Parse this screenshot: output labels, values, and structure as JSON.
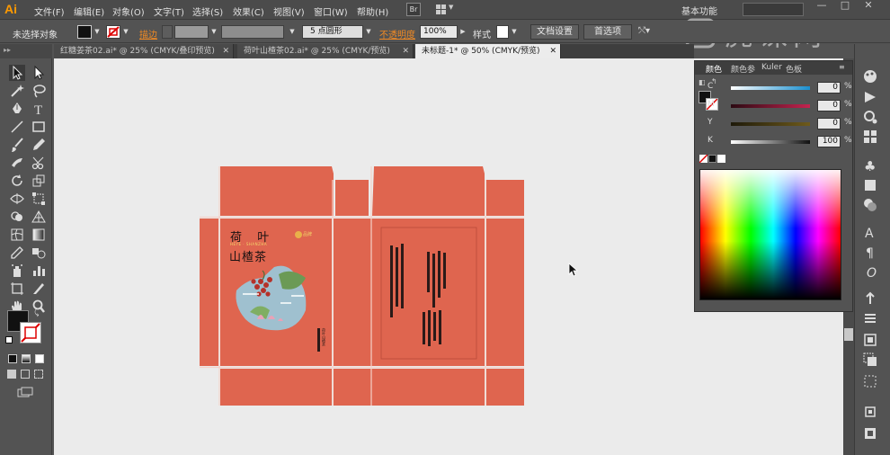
{
  "app": {
    "logo": "Ai"
  },
  "menu": [
    "文件(F)",
    "编辑(E)",
    "对象(O)",
    "文字(T)",
    "选择(S)",
    "效果(C)",
    "视图(V)",
    "窗口(W)",
    "帮助(H)"
  ],
  "bridge_label": "Br",
  "workspace": {
    "label": "基本功能"
  },
  "window_controls": {
    "minimize": "—",
    "restore": "□",
    "close": "✕"
  },
  "watermark": {
    "text": "虎课网"
  },
  "control_bar": {
    "selection_status": "未选择对象",
    "stroke_label": "描边",
    "brush_value": "5 点圆形",
    "opacity_label": "不透明度",
    "opacity_value": "100%",
    "style_label": "样式",
    "doc_setup_button": "文档设置",
    "preferences_button": "首选项"
  },
  "tabs": [
    {
      "title": "红糖姜茶02.ai* @ 25% (CMYK/叠印预览)",
      "active": false,
      "close": "✕"
    },
    {
      "title": "荷叶山楂茶02.ai* @ 25% (CMYK/预览)",
      "active": false,
      "close": "✕"
    },
    {
      "title": "未标题-1* @ 50% (CMYK/预览)",
      "active": true,
      "close": "✕"
    }
  ],
  "color_panel": {
    "tabs": [
      "颜色",
      "颜色参",
      "Kuler",
      "色板"
    ],
    "channels": [
      {
        "label": "C",
        "value": "0",
        "unit": "%",
        "color": "#3a8fc4"
      },
      {
        "label": "M",
        "value": "0",
        "unit": "%",
        "color": "#c43a7a"
      },
      {
        "label": "Y",
        "value": "0",
        "unit": "%",
        "color": "#c4b43a"
      },
      {
        "label": "K",
        "value": "100",
        "unit": "%",
        "color": "#111111"
      }
    ],
    "fill_color": "#111111"
  },
  "package": {
    "title_line1": "荷  叶",
    "subtitle": "HEYE · SHANZHA",
    "title_line2": "山楂茶",
    "brand_mark": "品牌",
    "side_text": "荷叶山楂茶",
    "panel_color": "#df654f"
  },
  "icons": {
    "selection": "selection-tool-icon",
    "direct_selection": "direct-selection-tool-icon",
    "pen": "pen-tool-icon",
    "type": "type-tool-icon",
    "zoom": "zoom-tool-icon",
    "hand": "hand-tool-icon"
  }
}
